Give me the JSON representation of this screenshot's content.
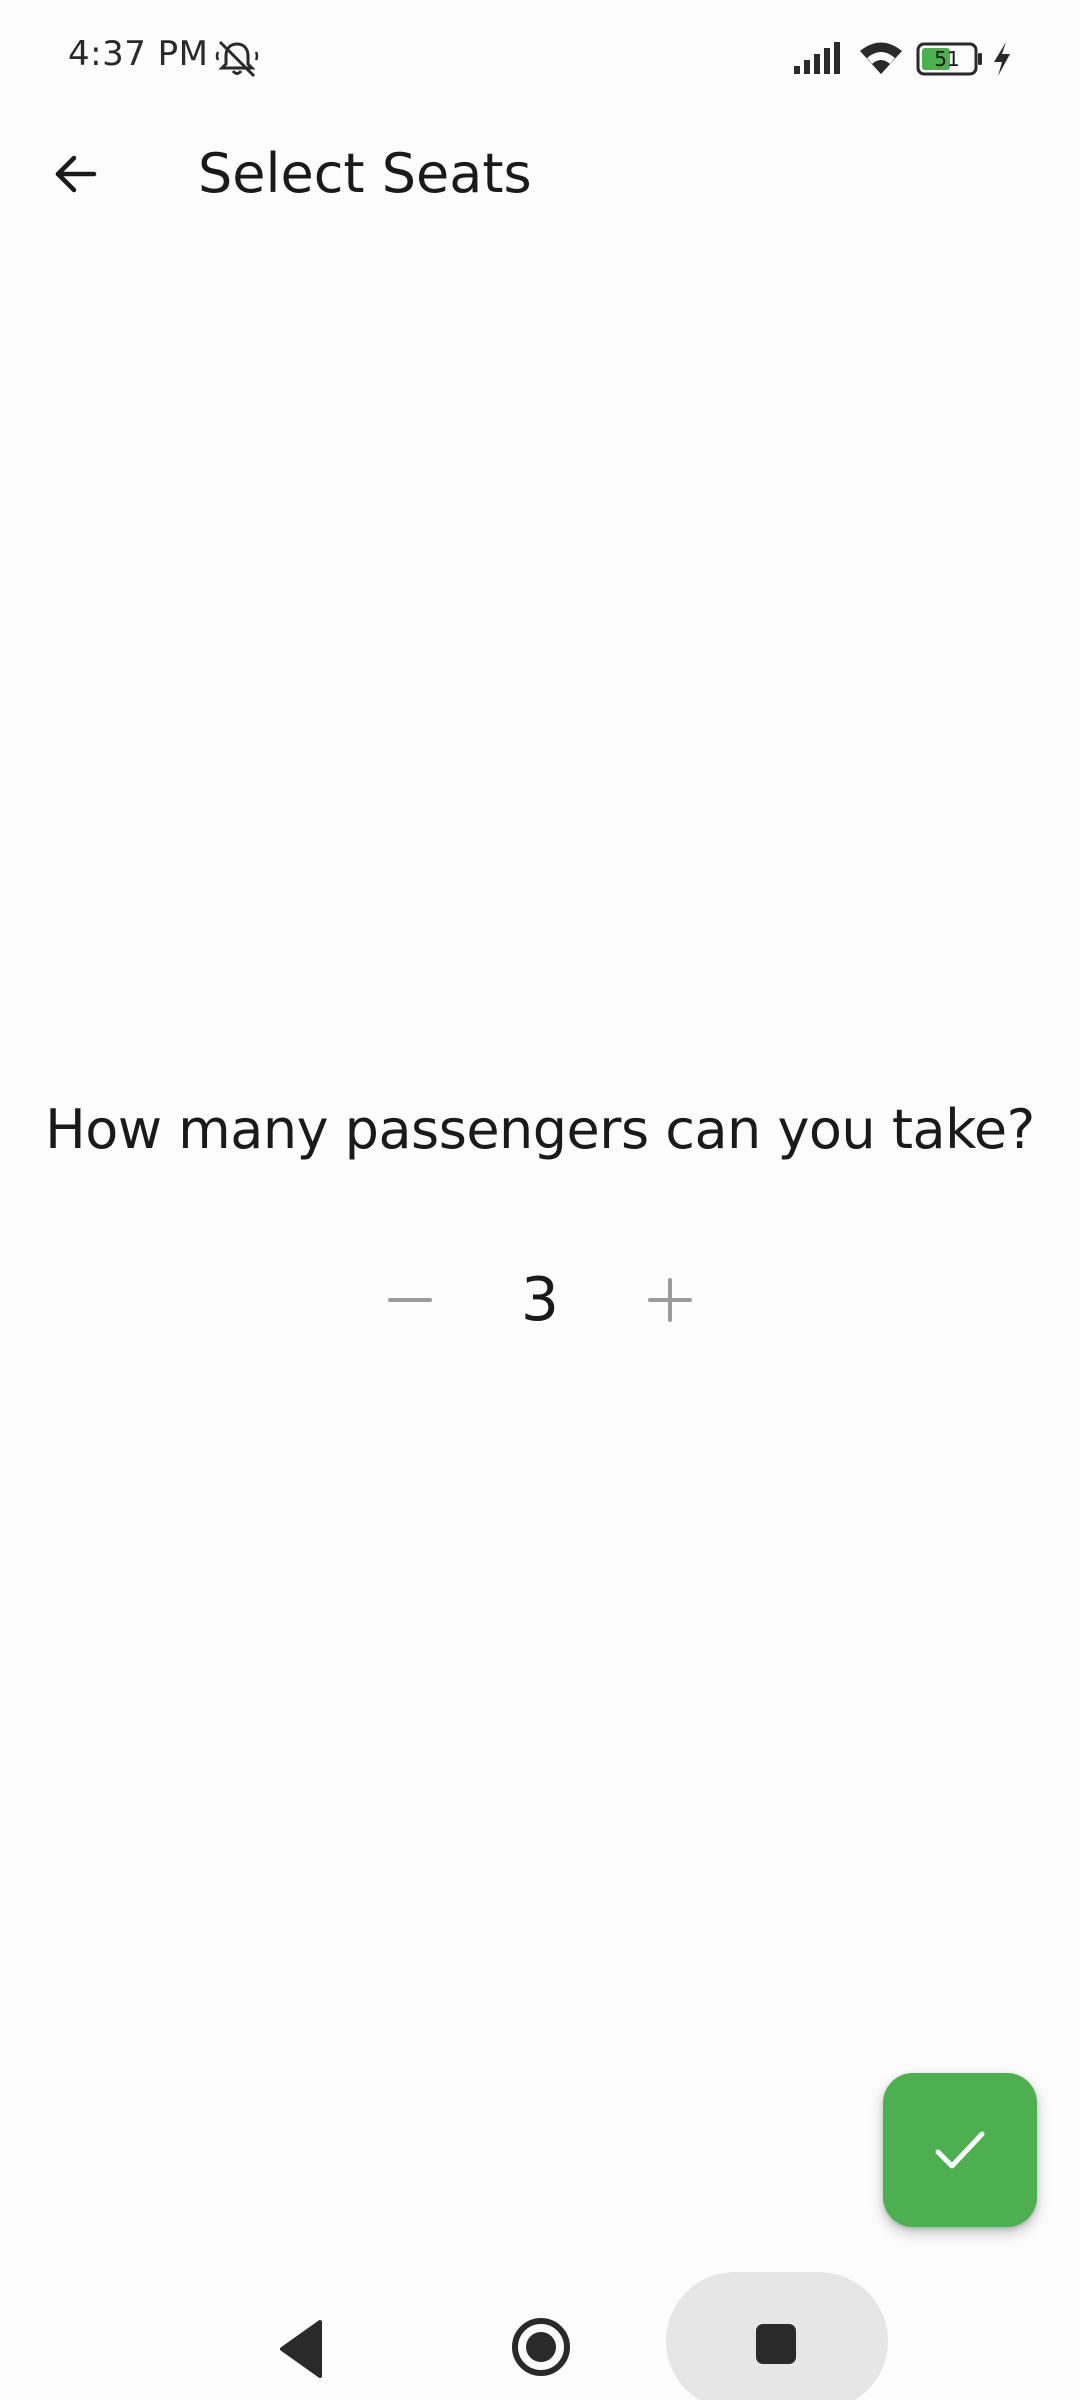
{
  "status_bar": {
    "time": "4:37 PM",
    "battery_level": "51",
    "icons": [
      "mute-icon",
      "signal-icon",
      "wifi-icon",
      "battery-icon",
      "charging-bolt-icon"
    ]
  },
  "app_bar": {
    "back_icon": "arrow-left-icon",
    "title": "Select Seats"
  },
  "main": {
    "question": "How many passengers can you take?",
    "stepper": {
      "value": "3",
      "decrement_icon": "minus-icon",
      "increment_icon": "plus-icon"
    }
  },
  "fab": {
    "icon": "check-icon",
    "color": "#4caf50"
  },
  "nav_bar": {
    "icons": [
      "nav-back-icon",
      "nav-home-icon",
      "nav-recents-icon"
    ]
  }
}
